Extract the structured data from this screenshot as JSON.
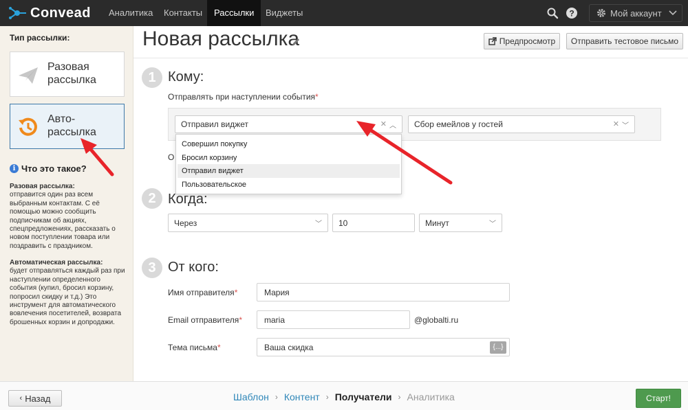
{
  "app": {
    "name": "Convead"
  },
  "nav": {
    "items": [
      {
        "label": "Аналитика",
        "active": false
      },
      {
        "label": "Контакты",
        "active": false
      },
      {
        "label": "Рассылки",
        "active": true
      },
      {
        "label": "Виджеты",
        "active": false
      }
    ],
    "account_label": "Мой аккаунт"
  },
  "sidebar": {
    "title": "Тип рассылки:",
    "types": [
      {
        "label": "Разовая рассылка",
        "active": false
      },
      {
        "label": "Авто-рассылка",
        "active": true
      }
    ],
    "what_title": "Что это такое?",
    "help": [
      {
        "title": "Разовая рассылка:",
        "text": "отправится один раз всем выбранным контактам. С её помощью можно сообщить подписчикам об акциях, спецпредложениях, рассказать о новом поступлении товара или поздравить с праздником."
      },
      {
        "title": "Автоматическая рассылка:",
        "text": "будет отправляться каждый раз при наступлении определенного события (купил, бросил корзину, попросил скидку и т.д.) Это инструмент для автоматического вовлечения посетителей, возврата брошенных корзин и допродажи."
      }
    ]
  },
  "header": {
    "title": "Новая рассылка",
    "preview_label": "Предпросмотр",
    "test_label": "Отправить тестовое письмо"
  },
  "steps": {
    "who": {
      "num": "1",
      "title": "Кому:",
      "event_label": "Отправлять при наступлении события",
      "event_value": "Отправил виджет",
      "widget_value": "Сбор емейлов у гостей",
      "dropdown_options": [
        {
          "label": "Совершил покупку",
          "highlighted": false
        },
        {
          "label": "Бросил корзину",
          "highlighted": false
        },
        {
          "label": "Отправил виджет",
          "highlighted": true
        },
        {
          "label": "Пользовательское",
          "highlighted": false
        }
      ],
      "obscured_text": "О"
    },
    "when": {
      "num": "2",
      "title": "Когда:",
      "mode_value": "Через",
      "amount_value": "10",
      "unit_value": "Минут"
    },
    "from": {
      "num": "3",
      "title": "От кого:",
      "name_label": "Имя отправителя",
      "name_value": "Мария",
      "email_label": "Email отправителя",
      "email_value": "maria",
      "email_domain": "@globalti.ru",
      "subject_label": "Тема письма",
      "subject_value": "Ваша скидка",
      "var_button": "{...}"
    }
  },
  "footer": {
    "back_label": "Назад",
    "breadcrumbs": [
      {
        "label": "Шаблон",
        "state": "done"
      },
      {
        "label": "Контент",
        "state": "done"
      },
      {
        "label": "Получатели",
        "state": "current"
      },
      {
        "label": "Аналитика",
        "state": "disabled"
      }
    ],
    "start_label": "Старт!"
  },
  "colors": {
    "nav_bg": "#2b2b2b",
    "sidebar_bg": "#f5f1e9",
    "accent_blue": "#2e86b8",
    "start_green": "#4e9a4e",
    "annotation_red": "#e8242a"
  }
}
